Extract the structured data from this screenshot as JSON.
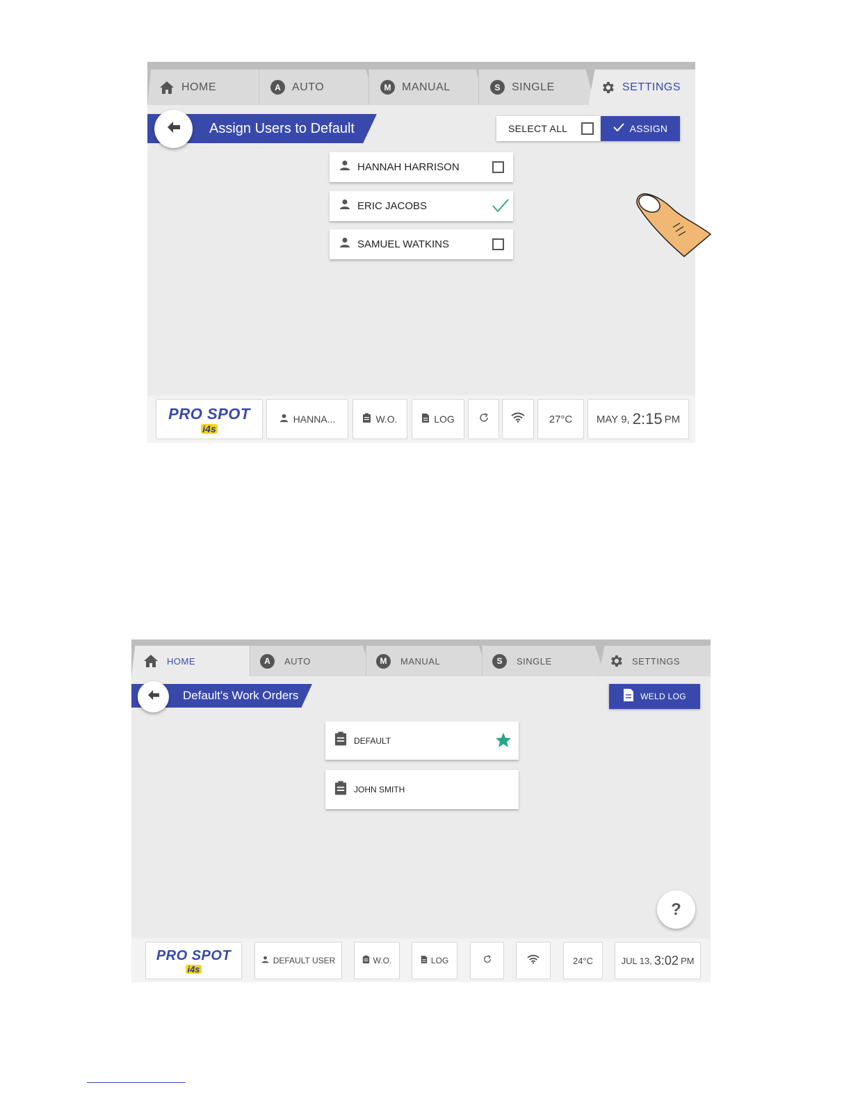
{
  "colors": {
    "accent": "#3949ab",
    "check": "#3aa389",
    "star": "#2aa58a",
    "background": "#ebebeb"
  },
  "screen1": {
    "tabs": [
      {
        "label": "HOME",
        "icon": "home-icon",
        "active": false
      },
      {
        "label": "AUTO",
        "icon": "A",
        "active": false
      },
      {
        "label": "MANUAL",
        "icon": "M",
        "active": false
      },
      {
        "label": "SINGLE",
        "icon": "S",
        "active": false
      },
      {
        "label": "SETTINGS",
        "icon": "gear-icon",
        "active": true
      }
    ],
    "title": "Assign Users to Default",
    "select_all_label": "SELECT ALL",
    "assign_label": "ASSIGN",
    "users": [
      {
        "name": "HANNAH HARRISON",
        "checked": false
      },
      {
        "name": "ERIC JACOBS",
        "checked": true
      },
      {
        "name": "SAMUEL WATKINS",
        "checked": false
      }
    ],
    "status": {
      "logo_main": "PRO SPOT",
      "logo_sub": "i4s",
      "user": "HANNA...",
      "wo": "W.O.",
      "log": "LOG",
      "temperature": "27°C",
      "date": "MAY 9,",
      "time": "2:15",
      "ampm": "PM"
    }
  },
  "screen2": {
    "tabs": [
      {
        "label": "HOME",
        "icon": "home-icon",
        "active": true
      },
      {
        "label": "AUTO",
        "icon": "A",
        "active": false
      },
      {
        "label": "MANUAL",
        "icon": "M",
        "active": false
      },
      {
        "label": "SINGLE",
        "icon": "S",
        "active": false
      },
      {
        "label": "SETTINGS",
        "icon": "gear-icon",
        "active": false
      }
    ],
    "title": "Default's Work Orders",
    "weld_log_label": "WELD LOG",
    "work_orders": [
      {
        "name": "DEFAULT",
        "favorite": true
      },
      {
        "name": "JOHN SMITH",
        "favorite": false
      }
    ],
    "help_label": "?",
    "status": {
      "logo_main": "PRO SPOT",
      "logo_sub": "i4s",
      "user": "DEFAULT USER",
      "wo": "W.O.",
      "log": "LOG",
      "temperature": "24°C",
      "date": "JUL 13,",
      "time": "3:02",
      "ampm": "PM"
    }
  }
}
